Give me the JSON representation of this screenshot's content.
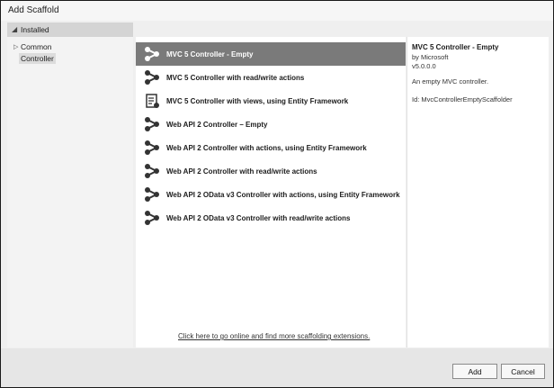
{
  "window": {
    "title": "Add Scaffold"
  },
  "sidebar": {
    "header": "Installed",
    "items": [
      {
        "label": "Common"
      },
      {
        "label": "Controller"
      }
    ]
  },
  "scaffolds": [
    {
      "label": "MVC 5 Controller - Empty",
      "icon": "controller-icon",
      "selected": true
    },
    {
      "label": "MVC 5 Controller with read/write actions",
      "icon": "controller-icon"
    },
    {
      "label": "MVC 5 Controller with views, using Entity Framework",
      "icon": "controller-views-icon"
    },
    {
      "label": "Web API 2 Controller – Empty",
      "icon": "controller-icon"
    },
    {
      "label": "Web API 2 Controller with actions, using Entity Framework",
      "icon": "controller-icon"
    },
    {
      "label": "Web API 2 Controller with read/write actions",
      "icon": "controller-icon"
    },
    {
      "label": "Web API 2 OData v3 Controller with actions, using Entity Framework",
      "icon": "controller-icon"
    },
    {
      "label": "Web API 2 OData v3 Controller with read/write actions",
      "icon": "controller-icon"
    }
  ],
  "online_link": "Click here to go online and find more scaffolding extensions.",
  "details": {
    "title": "MVC 5 Controller - Empty",
    "author": "by Microsoft",
    "version": "v5.0.0.0",
    "description": "An empty MVC controller.",
    "id": "Id: MvcControllerEmptyScaffolder"
  },
  "buttons": {
    "add": "Add",
    "cancel": "Cancel"
  }
}
